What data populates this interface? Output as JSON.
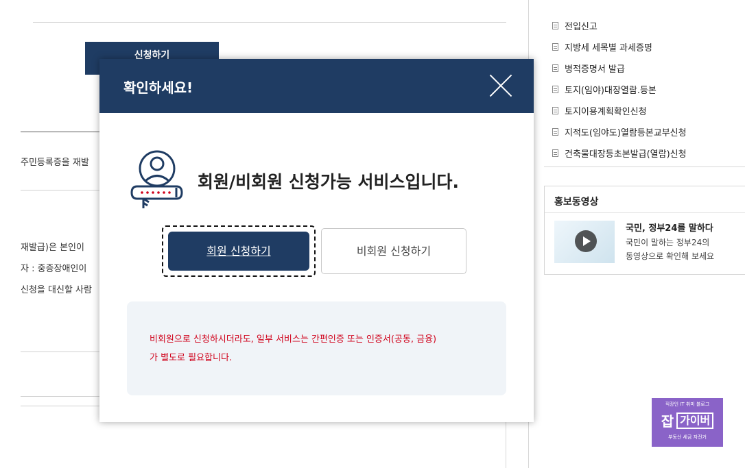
{
  "background": {
    "apply_button_label": "신청하기",
    "lines": [
      "주민등록증을 재발",
      "재발급)은 본인이",
      "자 : 중증장애인이",
      "신청을 대신할 사람"
    ]
  },
  "sidebar": {
    "items": [
      {
        "label": "전입신고"
      },
      {
        "label": "지방세 세목별 과세증명"
      },
      {
        "label": "병적증명서 발급"
      },
      {
        "label": "토지(임야)대장열람.등본"
      },
      {
        "label": "토지이용계획확인신청"
      },
      {
        "label": "지적도(임야도)열람등본교부신청"
      },
      {
        "label": "건축물대장등초본발급(열람)신청"
      }
    ],
    "promo": {
      "title": "홍보동영상",
      "video_title": "국민, 정부24를 말하다",
      "video_desc_line1": "국민이 말하는 정부24의",
      "video_desc_line2": "동영상으로 확인해 보세요"
    }
  },
  "modal": {
    "title": "확인하세요!",
    "close_icon": "close-icon",
    "service_icon": "user-login-icon",
    "message": "회원/비회원 신청가능 서비스입니다.",
    "member_button_label": "회원 신청하기",
    "guest_button_label": "비회원 신청하기",
    "notice_line1": "비회원으로 신청하시더라도, 일부 서비스는 간편인증 또는 인증서(공동, 금융)",
    "notice_line2": "가 별도로 필요합니다.",
    "colors": {
      "header": "#1f3c63",
      "notice_text": "#d0021b",
      "notice_bg": "#f0f4f8"
    }
  },
  "watermark": {
    "top_text": "직장인 IT 취미 블로그",
    "main_j": "잡",
    "main_g": "가이버",
    "bottom_text": "부동산 세금 자전거"
  }
}
